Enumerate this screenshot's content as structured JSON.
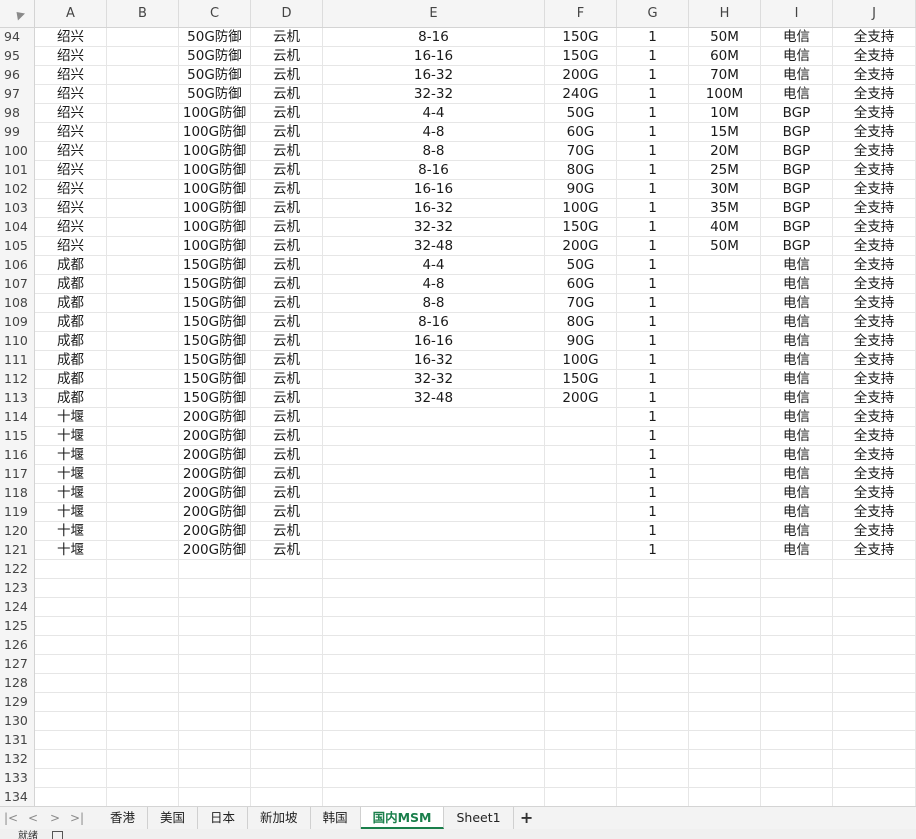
{
  "columns": [
    {
      "label": "A",
      "width": 72
    },
    {
      "label": "B",
      "width": 72
    },
    {
      "label": "C",
      "width": 72
    },
    {
      "label": "D",
      "width": 72
    },
    {
      "label": "E",
      "width": 222
    },
    {
      "label": "F",
      "width": 72
    },
    {
      "label": "G",
      "width": 72
    },
    {
      "label": "H",
      "width": 72
    },
    {
      "label": "I",
      "width": 72
    },
    {
      "label": "J",
      "width": 83
    }
  ],
  "rows": [
    {
      "n": "94",
      "c": [
        "绍兴",
        "",
        "50G防御",
        "云机",
        "8-16",
        "150G",
        "1",
        "50M",
        "电信",
        "全支持"
      ]
    },
    {
      "n": "95",
      "c": [
        "绍兴",
        "",
        "50G防御",
        "云机",
        "16-16",
        "150G",
        "1",
        "60M",
        "电信",
        "全支持"
      ]
    },
    {
      "n": "96",
      "c": [
        "绍兴",
        "",
        "50G防御",
        "云机",
        "16-32",
        "200G",
        "1",
        "70M",
        "电信",
        "全支持"
      ]
    },
    {
      "n": "97",
      "c": [
        "绍兴",
        "",
        "50G防御",
        "云机",
        "32-32",
        "240G",
        "1",
        "100M",
        "电信",
        "全支持"
      ]
    },
    {
      "n": "98",
      "c": [
        "绍兴",
        "",
        "100G防御",
        "云机",
        "4-4",
        "50G",
        "1",
        "10M",
        "BGP",
        "全支持"
      ]
    },
    {
      "n": "99",
      "c": [
        "绍兴",
        "",
        "100G防御",
        "云机",
        "4-8",
        "60G",
        "1",
        "15M",
        "BGP",
        "全支持"
      ]
    },
    {
      "n": "100",
      "c": [
        "绍兴",
        "",
        "100G防御",
        "云机",
        "8-8",
        "70G",
        "1",
        "20M",
        "BGP",
        "全支持"
      ]
    },
    {
      "n": "101",
      "c": [
        "绍兴",
        "",
        "100G防御",
        "云机",
        "8-16",
        "80G",
        "1",
        "25M",
        "BGP",
        "全支持"
      ]
    },
    {
      "n": "102",
      "c": [
        "绍兴",
        "",
        "100G防御",
        "云机",
        "16-16",
        "90G",
        "1",
        "30M",
        "BGP",
        "全支持"
      ]
    },
    {
      "n": "103",
      "c": [
        "绍兴",
        "",
        "100G防御",
        "云机",
        "16-32",
        "100G",
        "1",
        "35M",
        "BGP",
        "全支持"
      ]
    },
    {
      "n": "104",
      "c": [
        "绍兴",
        "",
        "100G防御",
        "云机",
        "32-32",
        "150G",
        "1",
        "40M",
        "BGP",
        "全支持"
      ]
    },
    {
      "n": "105",
      "c": [
        "绍兴",
        "",
        "100G防御",
        "云机",
        "32-48",
        "200G",
        "1",
        "50M",
        "BGP",
        "全支持"
      ]
    },
    {
      "n": "106",
      "c": [
        "成都",
        "",
        "150G防御",
        "云机",
        "4-4",
        "50G",
        "1",
        "",
        "电信",
        "全支持"
      ]
    },
    {
      "n": "107",
      "c": [
        "成都",
        "",
        "150G防御",
        "云机",
        "4-8",
        "60G",
        "1",
        "",
        "电信",
        "全支持"
      ]
    },
    {
      "n": "108",
      "c": [
        "成都",
        "",
        "150G防御",
        "云机",
        "8-8",
        "70G",
        "1",
        "",
        "电信",
        "全支持"
      ]
    },
    {
      "n": "109",
      "c": [
        "成都",
        "",
        "150G防御",
        "云机",
        "8-16",
        "80G",
        "1",
        "",
        "电信",
        "全支持"
      ]
    },
    {
      "n": "110",
      "c": [
        "成都",
        "",
        "150G防御",
        "云机",
        "16-16",
        "90G",
        "1",
        "",
        "电信",
        "全支持"
      ]
    },
    {
      "n": "111",
      "c": [
        "成都",
        "",
        "150G防御",
        "云机",
        "16-32",
        "100G",
        "1",
        "",
        "电信",
        "全支持"
      ]
    },
    {
      "n": "112",
      "c": [
        "成都",
        "",
        "150G防御",
        "云机",
        "32-32",
        "150G",
        "1",
        "",
        "电信",
        "全支持"
      ]
    },
    {
      "n": "113",
      "c": [
        "成都",
        "",
        "150G防御",
        "云机",
        "32-48",
        "200G",
        "1",
        "",
        "电信",
        "全支持"
      ]
    },
    {
      "n": "114",
      "c": [
        "十堰",
        "",
        "200G防御",
        "云机",
        "",
        "",
        "1",
        "",
        "电信",
        "全支持"
      ]
    },
    {
      "n": "115",
      "c": [
        "十堰",
        "",
        "200G防御",
        "云机",
        "",
        "",
        "1",
        "",
        "电信",
        "全支持"
      ]
    },
    {
      "n": "116",
      "c": [
        "十堰",
        "",
        "200G防御",
        "云机",
        "",
        "",
        "1",
        "",
        "电信",
        "全支持"
      ]
    },
    {
      "n": "117",
      "c": [
        "十堰",
        "",
        "200G防御",
        "云机",
        "",
        "",
        "1",
        "",
        "电信",
        "全支持"
      ]
    },
    {
      "n": "118",
      "c": [
        "十堰",
        "",
        "200G防御",
        "云机",
        "",
        "",
        "1",
        "",
        "电信",
        "全支持"
      ]
    },
    {
      "n": "119",
      "c": [
        "十堰",
        "",
        "200G防御",
        "云机",
        "",
        "",
        "1",
        "",
        "电信",
        "全支持"
      ]
    },
    {
      "n": "120",
      "c": [
        "十堰",
        "",
        "200G防御",
        "云机",
        "",
        "",
        "1",
        "",
        "电信",
        "全支持"
      ]
    },
    {
      "n": "121",
      "c": [
        "十堰",
        "",
        "200G防御",
        "云机",
        "",
        "",
        "1",
        "",
        "电信",
        "全支持"
      ]
    },
    {
      "n": "122",
      "c": [
        "",
        "",
        "",
        "",
        "",
        "",
        "",
        "",
        "",
        ""
      ]
    },
    {
      "n": "123",
      "c": [
        "",
        "",
        "",
        "",
        "",
        "",
        "",
        "",
        "",
        ""
      ]
    },
    {
      "n": "124",
      "c": [
        "",
        "",
        "",
        "",
        "",
        "",
        "",
        "",
        "",
        ""
      ]
    },
    {
      "n": "125",
      "c": [
        "",
        "",
        "",
        "",
        "",
        "",
        "",
        "",
        "",
        ""
      ]
    },
    {
      "n": "126",
      "c": [
        "",
        "",
        "",
        "",
        "",
        "",
        "",
        "",
        "",
        ""
      ]
    },
    {
      "n": "127",
      "c": [
        "",
        "",
        "",
        "",
        "",
        "",
        "",
        "",
        "",
        ""
      ]
    },
    {
      "n": "128",
      "c": [
        "",
        "",
        "",
        "",
        "",
        "",
        "",
        "",
        "",
        ""
      ]
    },
    {
      "n": "129",
      "c": [
        "",
        "",
        "",
        "",
        "",
        "",
        "",
        "",
        "",
        ""
      ]
    },
    {
      "n": "130",
      "c": [
        "",
        "",
        "",
        "",
        "",
        "",
        "",
        "",
        "",
        ""
      ]
    },
    {
      "n": "131",
      "c": [
        "",
        "",
        "",
        "",
        "",
        "",
        "",
        "",
        "",
        ""
      ]
    },
    {
      "n": "132",
      "c": [
        "",
        "",
        "",
        "",
        "",
        "",
        "",
        "",
        "",
        ""
      ]
    },
    {
      "n": "133",
      "c": [
        "",
        "",
        "",
        "",
        "",
        "",
        "",
        "",
        "",
        ""
      ]
    },
    {
      "n": "134",
      "c": [
        "",
        "",
        "",
        "",
        "",
        "",
        "",
        "",
        "",
        ""
      ]
    }
  ],
  "tabs": [
    {
      "label": "香港",
      "active": false
    },
    {
      "label": "美国",
      "active": false
    },
    {
      "label": "日本",
      "active": false
    },
    {
      "label": "新加坡",
      "active": false
    },
    {
      "label": "韩国",
      "active": false
    },
    {
      "label": "国内MSM",
      "active": true
    },
    {
      "label": "Sheet1",
      "active": false
    }
  ],
  "nav": {
    "first": "|<",
    "prev": "<",
    "next": ">",
    "last": ">|"
  },
  "add_tab_label": "+",
  "status": {
    "left": "就绪"
  },
  "icons": {
    "corner": "select-all-triangle",
    "status": "sheet-icon"
  },
  "colors": {
    "active_tab": "#1a7f4b",
    "header_bg": "#f5f5f5",
    "gridline": "#e6e6e6"
  }
}
